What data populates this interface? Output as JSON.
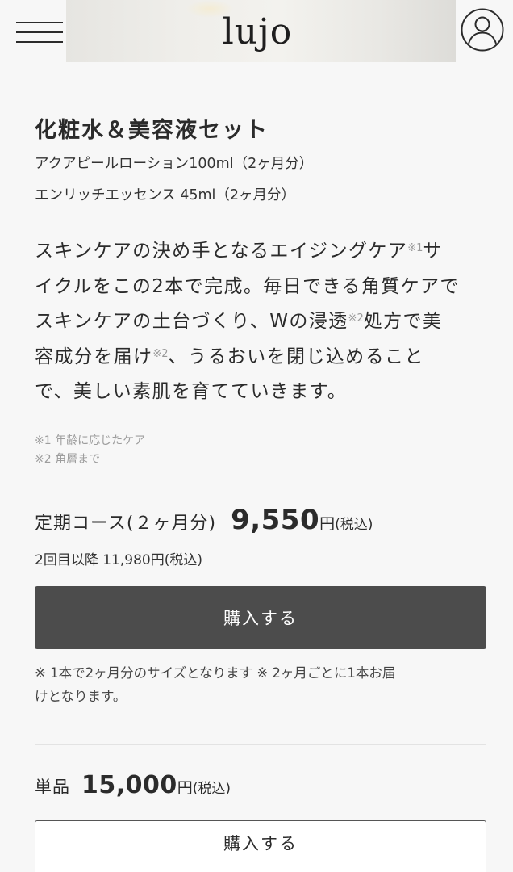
{
  "header": {
    "logo": "lujo",
    "menu_icon": "hamburger-menu-icon",
    "account_icon": "user-account-icon"
  },
  "product": {
    "title": "化粧水＆美容液セット",
    "items": [
      "アクアピールローション100ml（2ヶ月分）",
      "エンリッチエッセンス 45ml（2ヶ月分）"
    ],
    "description": {
      "line1_a": "スキンケアの決め手となるエイジングケア",
      "line1_sup": "※1",
      "line1_b": "サ",
      "line2": "イクルをこの2本で完成。毎日できる角質ケアで",
      "line3_a": "スキンケアの土台づくり、Wの浸透",
      "line3_sup": "※2",
      "line3_b": "処方で美",
      "line4_a": "容成分を届け",
      "line4_sup": "※2",
      "line4_b": "、うるおいを閉じ込めること",
      "line5": "で、美しい素肌を育てていきます。"
    },
    "notes": [
      "※1 年齢に応じたケア",
      "※2 角層まで"
    ]
  },
  "subscription": {
    "label": "定期コース(２ヶ月分)",
    "price": "9,550",
    "yen": "円",
    "tax": "(税込)",
    "second_onward": "2回目以降 11,980円(税込)",
    "buy_label": "購入する",
    "note_line1": "※ 1本で2ヶ月分のサイズとなります ※ 2ヶ月ごとに1本お届",
    "note_line2": "けとなります。"
  },
  "single": {
    "label": "単品",
    "price": "15,000",
    "yen": "円",
    "tax": "(税込)",
    "buy_label": "購入する"
  },
  "colors": {
    "background": "#f7f7f7",
    "primary_button": "#4c4c4c",
    "text": "#2b2b2b",
    "note_gray": "#9d9d9d"
  }
}
